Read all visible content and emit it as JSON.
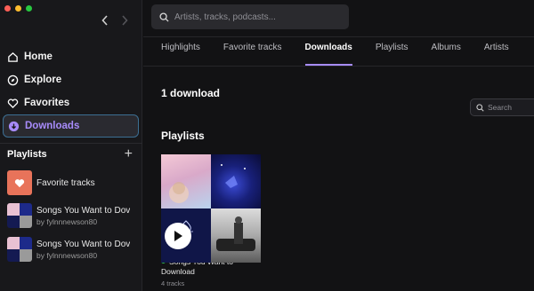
{
  "sidebar": {
    "nav": [
      {
        "label": "Home",
        "icon": "home-icon"
      },
      {
        "label": "Explore",
        "icon": "compass-icon"
      },
      {
        "label": "Favorites",
        "icon": "heart-icon"
      },
      {
        "label": "Downloads",
        "icon": "download-icon"
      }
    ],
    "active": "Downloads",
    "playlists_title": "Playlists",
    "playlists": [
      {
        "title": "Favorite tracks",
        "subtitle": ""
      },
      {
        "title": "Songs You Want to Dov",
        "subtitle": "by fylnnnewson80"
      },
      {
        "title": "Songs You Want to Dov",
        "subtitle": "by fylnnnewson80"
      }
    ]
  },
  "search": {
    "placeholder": "Artists, tracks, podcasts..."
  },
  "tabs": [
    "Highlights",
    "Favorite tracks",
    "Downloads",
    "Playlists",
    "Albums",
    "Artists"
  ],
  "active_tab": "Downloads",
  "main": {
    "count": "1 download",
    "filter_placeholder": "Search",
    "section_title": "Playlists",
    "card": {
      "title": "Songs You Want to Download",
      "subtitle": "4 tracks"
    }
  },
  "colors": {
    "accent": "#a78bfa",
    "status_green": "#2fbf4e",
    "focus_ring": "#3c6f93"
  }
}
